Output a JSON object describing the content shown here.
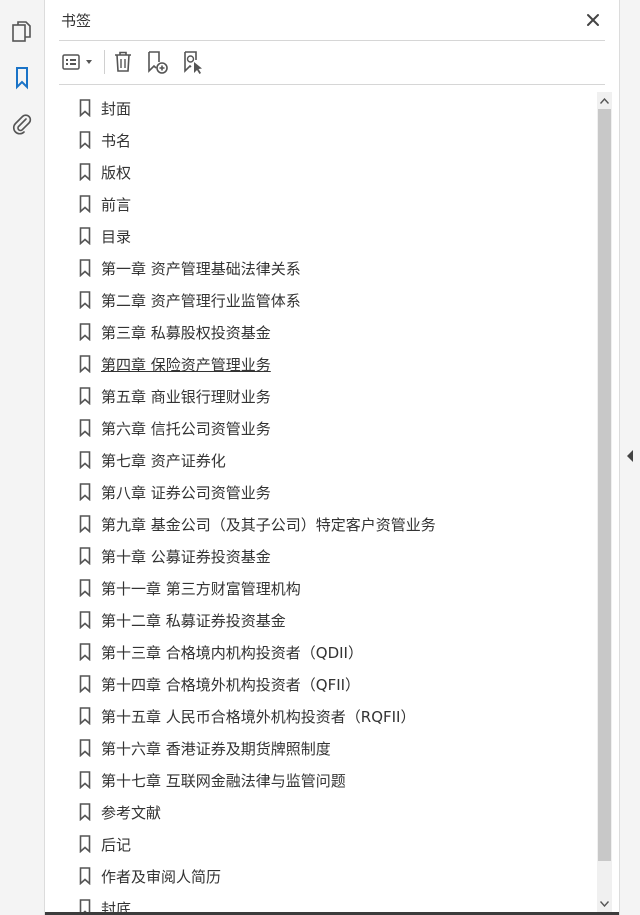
{
  "panel": {
    "title": "书签"
  },
  "bookmarks": [
    {
      "label": "封面"
    },
    {
      "label": "书名"
    },
    {
      "label": "版权"
    },
    {
      "label": "前言"
    },
    {
      "label": "目录"
    },
    {
      "label": "第一章 资产管理基础法律关系"
    },
    {
      "label": "第二章 资产管理行业监管体系"
    },
    {
      "label": "第三章 私募股权投资基金"
    },
    {
      "label": "第四章 保险资产管理业务"
    },
    {
      "label": "第五章 商业银行理财业务"
    },
    {
      "label": "第六章 信托公司资管业务"
    },
    {
      "label": "第七章 资产证券化"
    },
    {
      "label": "第八章 证券公司资管业务"
    },
    {
      "label": "第九章 基金公司（及其子公司）特定客户资管业务"
    },
    {
      "label": "第十章 公募证券投资基金"
    },
    {
      "label": "第十一章 第三方财富管理机构"
    },
    {
      "label": "第十二章 私募证券投资基金"
    },
    {
      "label": "第十三章 合格境内机构投资者（QDII）"
    },
    {
      "label": "第十四章 合格境外机构投资者（QFII）"
    },
    {
      "label": "第十五章 人民币合格境外机构投资者（RQFII）"
    },
    {
      "label": "第十六章 香港证券及期货牌照制度"
    },
    {
      "label": "第十七章 互联网金融法律与监管问题"
    },
    {
      "label": "参考文献"
    },
    {
      "label": "后记"
    },
    {
      "label": "作者及审阅人简历"
    },
    {
      "label": "封底"
    }
  ],
  "hovered_index": 8,
  "colors": {
    "accent": "#1a73c7",
    "icon": "#555555",
    "scroll_thumb": "#c8c8c8"
  },
  "icons": {
    "rail": [
      "pages-icon",
      "bookmark-panel-icon",
      "attachment-icon"
    ],
    "toolbar": [
      "options-menu-icon",
      "delete-icon",
      "new-bookmark-icon",
      "bookmark-from-selection-icon"
    ]
  }
}
